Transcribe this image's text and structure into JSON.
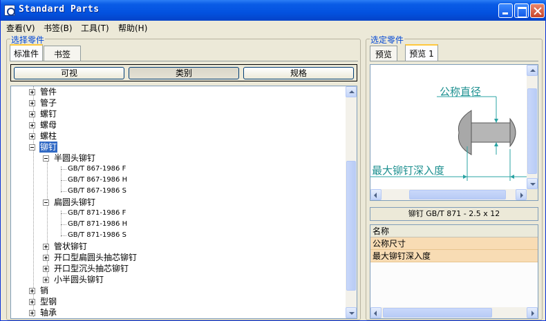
{
  "window": {
    "title": "Standard Parts"
  },
  "menu": [
    "查看(V)",
    "书签(B)",
    "工具(T)",
    "帮助(H)"
  ],
  "left": {
    "group_label": "选择零件",
    "tabs": [
      "标准件",
      "书签"
    ],
    "view_buttons": [
      "可视",
      "类别",
      "规格"
    ],
    "tree": [
      {
        "label": "管件"
      },
      {
        "label": "管子"
      },
      {
        "label": "螺钉"
      },
      {
        "label": "螺母"
      },
      {
        "label": "螺柱"
      },
      {
        "label": "铆钉"
      },
      {
        "label": "半圆头铆钉"
      },
      {
        "label": "GB/T 867-1986 F"
      },
      {
        "label": "GB/T 867-1986 H"
      },
      {
        "label": "GB/T 867-1986 S"
      },
      {
        "label": "扁圆头铆钉"
      },
      {
        "label": "GB/T 871-1986 F"
      },
      {
        "label": "GB/T 871-1986 H"
      },
      {
        "label": "GB/T 871-1986 S"
      },
      {
        "label": "管状铆钉"
      },
      {
        "label": "开口型扁圆头抽芯铆钉"
      },
      {
        "label": "开口型沉头抽芯铆钉"
      },
      {
        "label": "小半圆头铆钉"
      },
      {
        "label": "销"
      },
      {
        "label": "型钢"
      },
      {
        "label": "轴承"
      }
    ]
  },
  "right": {
    "group_label": "选定零件",
    "tabs": [
      "预览",
      "预览 1"
    ],
    "diagram": {
      "label_diameter": "公称直径",
      "label_depth": "最大铆钉深入度"
    },
    "part_name": "铆钉 GB/T 871 - 2.5 x 12",
    "props_header": "名称",
    "props": [
      "公称尺寸",
      "最大铆钉深入度"
    ]
  },
  "colors": {
    "selection": "#316ac5",
    "prop_row": "#f8dcb4",
    "diagram_line": "#2aa3a3"
  }
}
